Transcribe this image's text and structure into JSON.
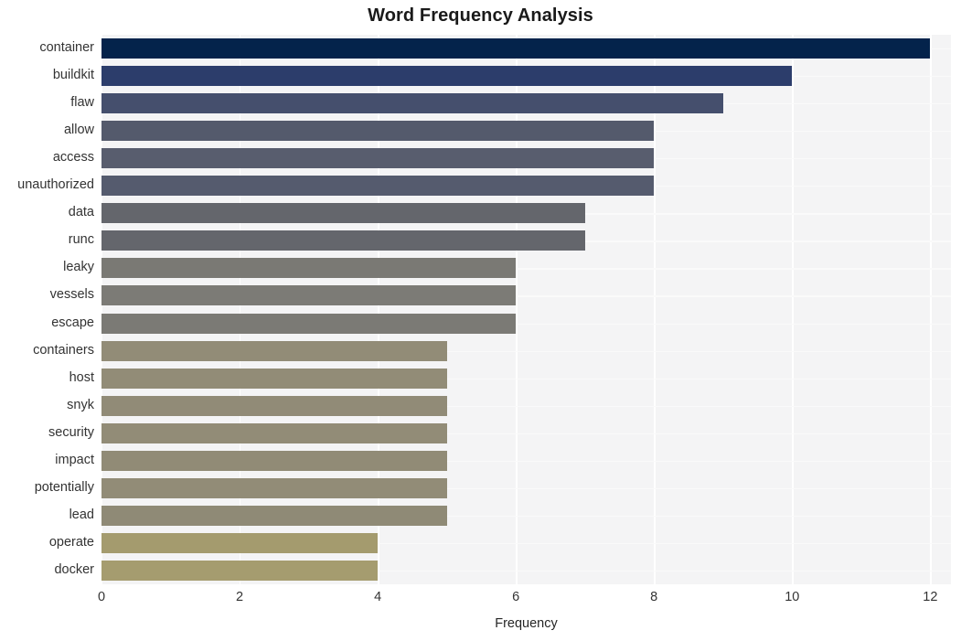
{
  "chart_data": {
    "type": "bar",
    "orientation": "horizontal",
    "title": "Word Frequency Analysis",
    "xlabel": "Frequency",
    "ylabel": "",
    "xlim": [
      0,
      12.3
    ],
    "xticks": [
      0,
      2,
      4,
      6,
      8,
      10,
      12
    ],
    "xtick_labels": [
      "0",
      "2",
      "4",
      "6",
      "8",
      "10",
      "12"
    ],
    "grid": true,
    "legend": null,
    "categories": [
      "container",
      "buildkit",
      "flaw",
      "allow",
      "access",
      "unauthorized",
      "data",
      "runc",
      "leaky",
      "vessels",
      "escape",
      "containers",
      "host",
      "snyk",
      "security",
      "impact",
      "potentially",
      "lead",
      "operate",
      "docker"
    ],
    "values": [
      12,
      10,
      9,
      8,
      8,
      8,
      7,
      7,
      6,
      6,
      6,
      5,
      5,
      5,
      5,
      5,
      5,
      5,
      4,
      4
    ],
    "bar_colors": [
      "#04234b",
      "#2c3d6b",
      "#454f6d",
      "#545a6c",
      "#585d6e",
      "#555b6e",
      "#64666c",
      "#64666c",
      "#7a7974",
      "#7c7b76",
      "#7b7a75",
      "#928c77",
      "#928c77",
      "#918b77",
      "#928c77",
      "#918b76",
      "#928c77",
      "#8f8a76",
      "#a49b6e",
      "#a59c6f"
    ],
    "plot_background": "#f4f4f5",
    "figure_background": "#ffffff",
    "gridline_color": "#ffffff"
  },
  "axes": {
    "x_tick_values": [
      "0",
      "2",
      "4",
      "6",
      "8",
      "10",
      "12"
    ],
    "x_title": "Frequency"
  }
}
